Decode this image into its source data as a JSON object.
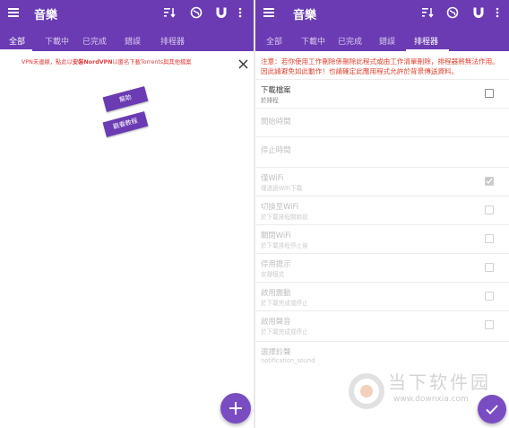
{
  "app": {
    "title": "音樂",
    "accent": "#6a3bb3"
  },
  "actions": [
    "sort-icon",
    "globe-icon",
    "magnet-icon",
    "more-vert-icon"
  ],
  "tabs": [
    {
      "label": "全部"
    },
    {
      "label": "下載中"
    },
    {
      "label": "已完成"
    },
    {
      "label": "錯誤"
    },
    {
      "label": "排程器"
    }
  ],
  "left": {
    "active_tab": "全部",
    "banner": {
      "prefix": "VPN未連線，點此以",
      "bold": "安裝NordVPN",
      "suffix": "以匿名下載Torrents與其他檔案"
    },
    "help_button": "幫助",
    "tutorial_button": "觀看教程"
  },
  "right": {
    "active_tab": "排程器",
    "warning": "注意：若你使用工作刪除係刪除此程式或由工作清單刪除，排程器將無法作用。因此請避免如此動作！也請確定此應用程式允許於背景傳送資料。",
    "settings": [
      {
        "title": "下載檔案",
        "subtitle": "於排程",
        "checked": false,
        "disabled": false,
        "checkbox": true
      },
      {
        "title": "開始時間",
        "subtitle": "",
        "checked": false,
        "disabled": true,
        "checkbox": false
      },
      {
        "title": "停止時間",
        "subtitle": "",
        "checked": false,
        "disabled": true,
        "checkbox": false
      },
      {
        "title": "僅WiFi",
        "subtitle": "僅透過WiFi下載",
        "checked": true,
        "disabled": true,
        "checkbox": true
      },
      {
        "title": "切換至WiFi",
        "subtitle": "於下載排程開始前",
        "checked": false,
        "disabled": true,
        "checkbox": true
      },
      {
        "title": "關閉WiFi",
        "subtitle": "於下載排程停止後",
        "checked": false,
        "disabled": true,
        "checkbox": true
      },
      {
        "title": "停用提示",
        "subtitle": "安靜模式",
        "checked": false,
        "disabled": true,
        "checkbox": true
      },
      {
        "title": "啟用震動",
        "subtitle": "於下載完成或停止",
        "checked": false,
        "disabled": true,
        "checkbox": true
      },
      {
        "title": "啟用聲音",
        "subtitle": "於下載完成或停止",
        "checked": false,
        "disabled": true,
        "checkbox": true
      },
      {
        "title": "選擇鈴聲",
        "subtitle": "notification_sound",
        "checked": false,
        "disabled": true,
        "checkbox": false
      }
    ]
  },
  "watermark": {
    "text": "当下软件园",
    "url": "www.downxia.com"
  }
}
